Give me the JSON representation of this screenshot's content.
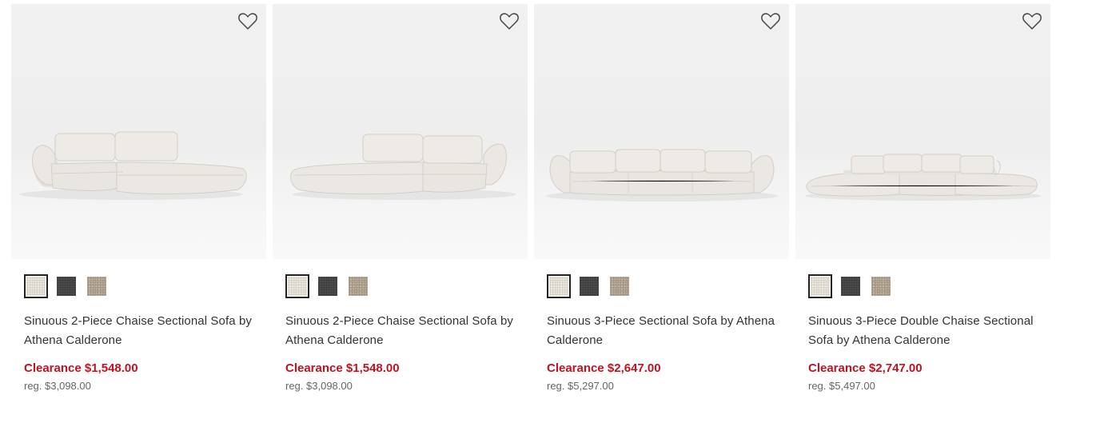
{
  "products": [
    {
      "title": "Sinuous 2-Piece Chaise Sectional Sofa by Athena Calderone",
      "clearance_price": "Clearance $1,548.00",
      "regular_price": "reg. $3,098.00",
      "favorite_icon": "heart-outline-icon",
      "selected_swatch": "ivory",
      "swatches": [
        "ivory",
        "charcoal",
        "taupe"
      ],
      "image": "sofa-chaise-right"
    },
    {
      "title": "Sinuous 2-Piece Chaise Sectional Sofa by Athena Calderone",
      "clearance_price": "Clearance $1,548.00",
      "regular_price": "reg. $3,098.00",
      "favorite_icon": "heart-outline-icon",
      "selected_swatch": "ivory",
      "swatches": [
        "ivory",
        "charcoal",
        "taupe"
      ],
      "image": "sofa-chaise-left"
    },
    {
      "title": "Sinuous 3-Piece Sectional Sofa by Athena Calderone",
      "clearance_price": "Clearance $2,647.00",
      "regular_price": "reg. $5,297.00",
      "favorite_icon": "heart-outline-icon",
      "selected_swatch": "ivory",
      "swatches": [
        "ivory",
        "charcoal",
        "taupe"
      ],
      "image": "sofa-3-piece"
    },
    {
      "title": "Sinuous 3-Piece Double Chaise Sectional Sofa by Athena Calderone",
      "clearance_price": "Clearance $2,747.00",
      "regular_price": "reg. $5,497.00",
      "favorite_icon": "heart-outline-icon",
      "selected_swatch": "ivory",
      "swatches": [
        "ivory",
        "charcoal",
        "taupe"
      ],
      "image": "sofa-double-chaise"
    }
  ],
  "colors": {
    "clearance": "#c1121f",
    "text": "#333333",
    "muted": "#666666",
    "swatch_ivory": "#e6e2da",
    "swatch_charcoal": "#4a4a4a",
    "swatch_taupe": "#b3a594"
  }
}
